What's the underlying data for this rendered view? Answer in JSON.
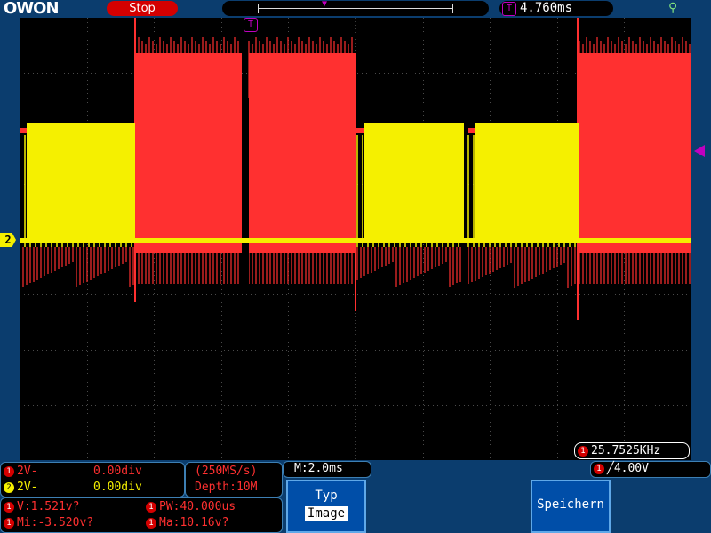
{
  "header": {
    "brand": "OWON",
    "run_state": "Stop",
    "trigger_delay": "4.760ms",
    "trigger_icon": "T",
    "usb_icon": "usb-icon"
  },
  "display": {
    "ch2_marker": "2",
    "frequency": "25.7525KHz",
    "ch1_icon": "1"
  },
  "channels": [
    {
      "num": "1",
      "volts": "2V-",
      "offset": "0.00div",
      "color": "#ff3030"
    },
    {
      "num": "2",
      "volts": "2V-",
      "offset": "0.00div",
      "color": "#f5f000"
    }
  ],
  "acquisition": {
    "sample_rate": "(250MS/s)",
    "depth": "Depth:10M"
  },
  "measurements": {
    "v": "V:1.521v?",
    "pw": "PW:40.000us",
    "mi": "Mi:-3.520v?",
    "ma": "Ma:10.16v?"
  },
  "timebase": "M:2.0ms",
  "trigger": {
    "channel": "1",
    "edge_symbol": "╱",
    "level": "4.00V"
  },
  "menu": {
    "type_label": "Typ",
    "type_value": "Image",
    "save_label": "Speichern"
  },
  "colors": {
    "background": "#0b3d6e",
    "ch1": "#ff3030",
    "ch2": "#f5f000",
    "trigger": "#c000c0"
  }
}
